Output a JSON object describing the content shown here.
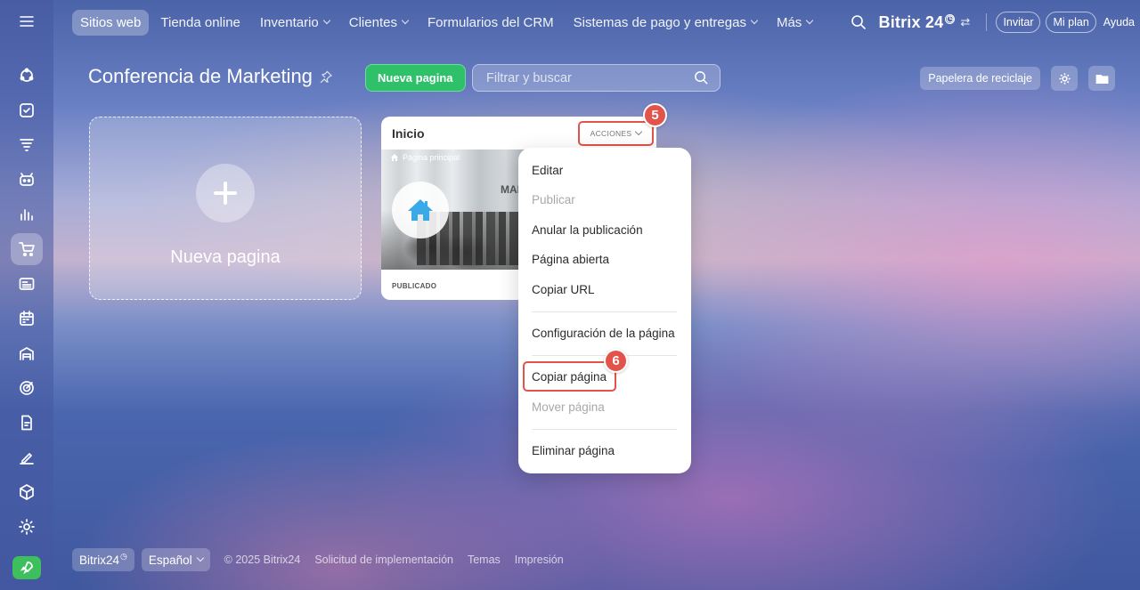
{
  "nav": {
    "items": [
      {
        "label": "Sitios web",
        "active": true,
        "chevron": false
      },
      {
        "label": "Tienda online",
        "active": false,
        "chevron": false
      },
      {
        "label": "Inventario",
        "active": false,
        "chevron": true
      },
      {
        "label": "Clientes",
        "active": false,
        "chevron": true
      },
      {
        "label": "Formularios del CRM",
        "active": false,
        "chevron": false
      },
      {
        "label": "Sistemas de pago y entregas",
        "active": false,
        "chevron": true
      },
      {
        "label": "Más",
        "active": false,
        "chevron": true
      }
    ],
    "brand": "Bitrix 24",
    "brand_mark": "◷",
    "brand_swap": "⇄",
    "invite": "Invitar",
    "plan": "Mi plan",
    "help": "Ayuda"
  },
  "sidebar": {
    "icons": [
      "menu-icon",
      "activity-icon",
      "tasks-icon",
      "funnel-icon",
      "robot-icon",
      "analytics-icon",
      "cart-icon",
      "news-icon",
      "calendar-icon",
      "warehouse-icon",
      "target-icon",
      "document-icon",
      "sign-icon",
      "cube-icon",
      "settings-icon",
      "rocket-icon"
    ],
    "active_icon": "cart-icon"
  },
  "header": {
    "title": "Conferencia de Marketing",
    "new_page_button": "Nueva pagina",
    "filter_placeholder": "Filtrar y buscar",
    "trash_button": "Papelera de reciclaje"
  },
  "new_card": {
    "label": "Nueva pagina"
  },
  "page_card": {
    "title": "Inicio",
    "actions_label": "ACCIONES",
    "main_page_label": "Página principal",
    "thumb_text": "MAR",
    "status": "PUBLICADO"
  },
  "menu": {
    "items": [
      {
        "label": "Editar",
        "disabled": false
      },
      {
        "label": "Publicar",
        "disabled": true
      },
      {
        "label": "Anular la publicación",
        "disabled": false
      },
      {
        "label": "Página abierta",
        "disabled": false
      },
      {
        "label": "Copiar URL",
        "disabled": false
      },
      {
        "label": "Configuración de la página",
        "disabled": false
      },
      {
        "label": "Copiar página",
        "disabled": false
      },
      {
        "label": "Mover página",
        "disabled": true
      },
      {
        "label": "Eliminar página",
        "disabled": false
      }
    ]
  },
  "badges": {
    "step5": "5",
    "step6": "6"
  },
  "footer": {
    "brand": "Bitrix24",
    "brand_mark": "◷",
    "language": "Español",
    "copyright": "© 2025 Bitrix24",
    "implementation": "Solicitud de implementación",
    "themes": "Temas",
    "print": "Impresión"
  },
  "colors": {
    "accent_green": "#2fc06a",
    "highlight_red": "#e2534b"
  }
}
